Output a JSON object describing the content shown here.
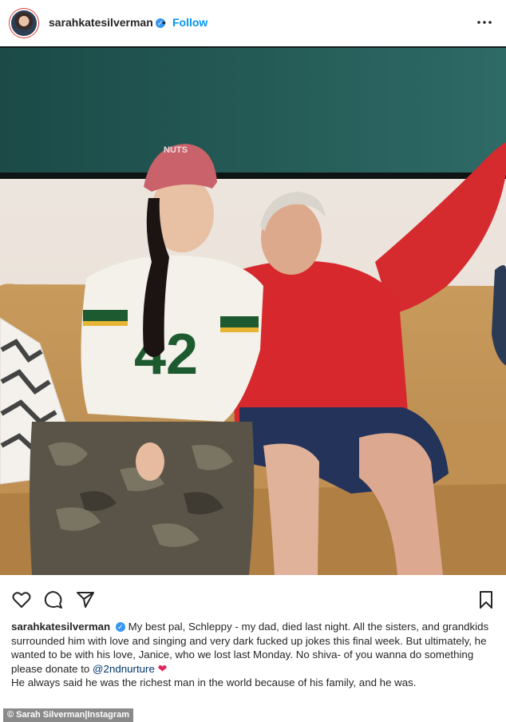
{
  "header": {
    "username": "sarahkatesilverman",
    "separator": "•",
    "follow_label": "Follow",
    "verified_icon": "verified-badge-icon",
    "more_icon": "more-options-icon"
  },
  "actions": {
    "like_icon": "heart-icon",
    "comment_icon": "comment-icon",
    "share_icon": "send-icon",
    "save_icon": "bookmark-icon"
  },
  "caption": {
    "username": "sarahkatesilverman",
    "text_1": "My best pal, Schleppy - my dad, died last night. All the sisters, and grandkids surrounded him with love and singing and very dark fucked up jokes this final week. But ultimately, he wanted to be with his love, Janice, who we lost last Monday. No shiva- of you wanna do something please donate to",
    "mention": "@2ndnurture",
    "heart": "❤",
    "text_2": "He always said he was the richest man in the world because of his family, and he was."
  },
  "photo": {
    "cap_text": "NUTS",
    "jersey_number": "42"
  },
  "credit": "© Sarah Silverman|Instagram",
  "colors": {
    "accent": "#0095f6",
    "mention": "#00376b",
    "verified": "#3897f0",
    "heart": "#e0245e"
  }
}
